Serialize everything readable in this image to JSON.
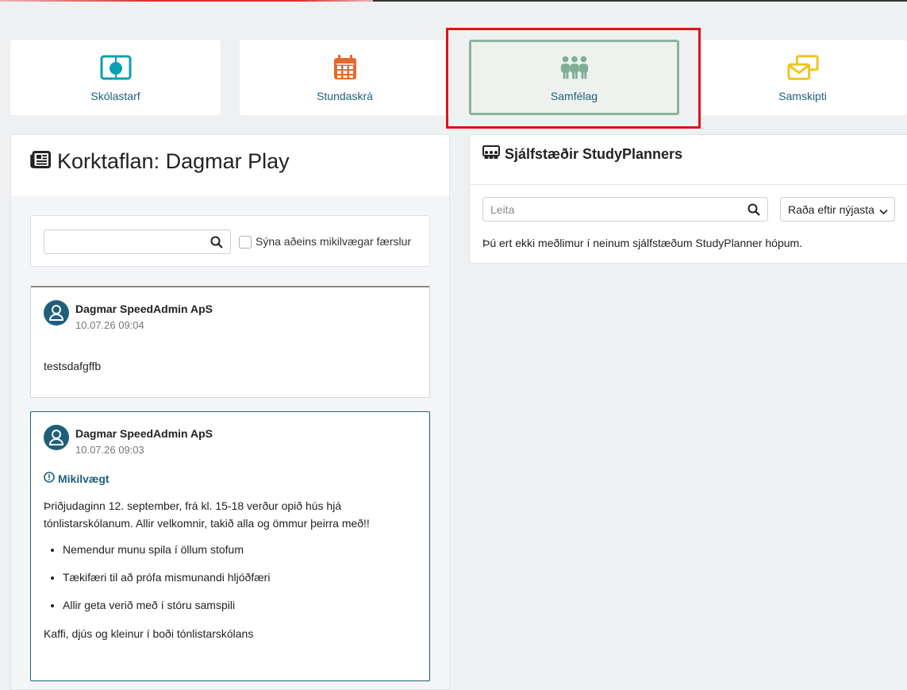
{
  "nav": {
    "items": [
      {
        "label": "Skólastarf",
        "icon": "book-apple-icon",
        "color": "#0a9fb0"
      },
      {
        "label": "Stundaskrá",
        "icon": "calendar-icon",
        "color": "#e36a2e"
      },
      {
        "label": "Samfélag",
        "icon": "community-icon",
        "color": "#7fae93",
        "active": true
      },
      {
        "label": "Samskipti",
        "icon": "messages-icon",
        "color": "#f0c419"
      }
    ]
  },
  "board": {
    "title": "Korktaflan: Dagmar Play",
    "filter_label": "Sýna aðeins mikilvægar færslur",
    "posts": [
      {
        "author": "Dagmar SpeedAdmin ApS",
        "date": "10.07.26 09:04",
        "body": "testsdafgffb"
      },
      {
        "author": "Dagmar SpeedAdmin ApS",
        "date": "10.07.26 09:03",
        "important_label": "Mikilvægt",
        "body": "Þriðjudaginn 12. september, frá kl. 15-18 verður opið hús hjá tónlistarskólanum. Allir velkomnir, takið alla og ömmur þeirra með!!",
        "bullets": [
          "Nemendur munu spila í öllum stofum",
          "Tækifæri til að prófa mismunandi hljóðfæri",
          "Allir geta verið með í stóru samspili"
        ],
        "footer": "Kaffi, djús og kleinur í boði tónlistarskólans"
      }
    ]
  },
  "studyplanners": {
    "title": "Sjálfstæðir StudyPlanners",
    "search_placeholder": "Leita",
    "sort_label": "Raða eftir nýjasta",
    "empty_message": "Þú ert ekki meðlimur í neinum sjálfstæðum StudyPlanner hópum."
  },
  "colors": {
    "accent": "#1f5f7a",
    "highlight": "#e0121a"
  }
}
